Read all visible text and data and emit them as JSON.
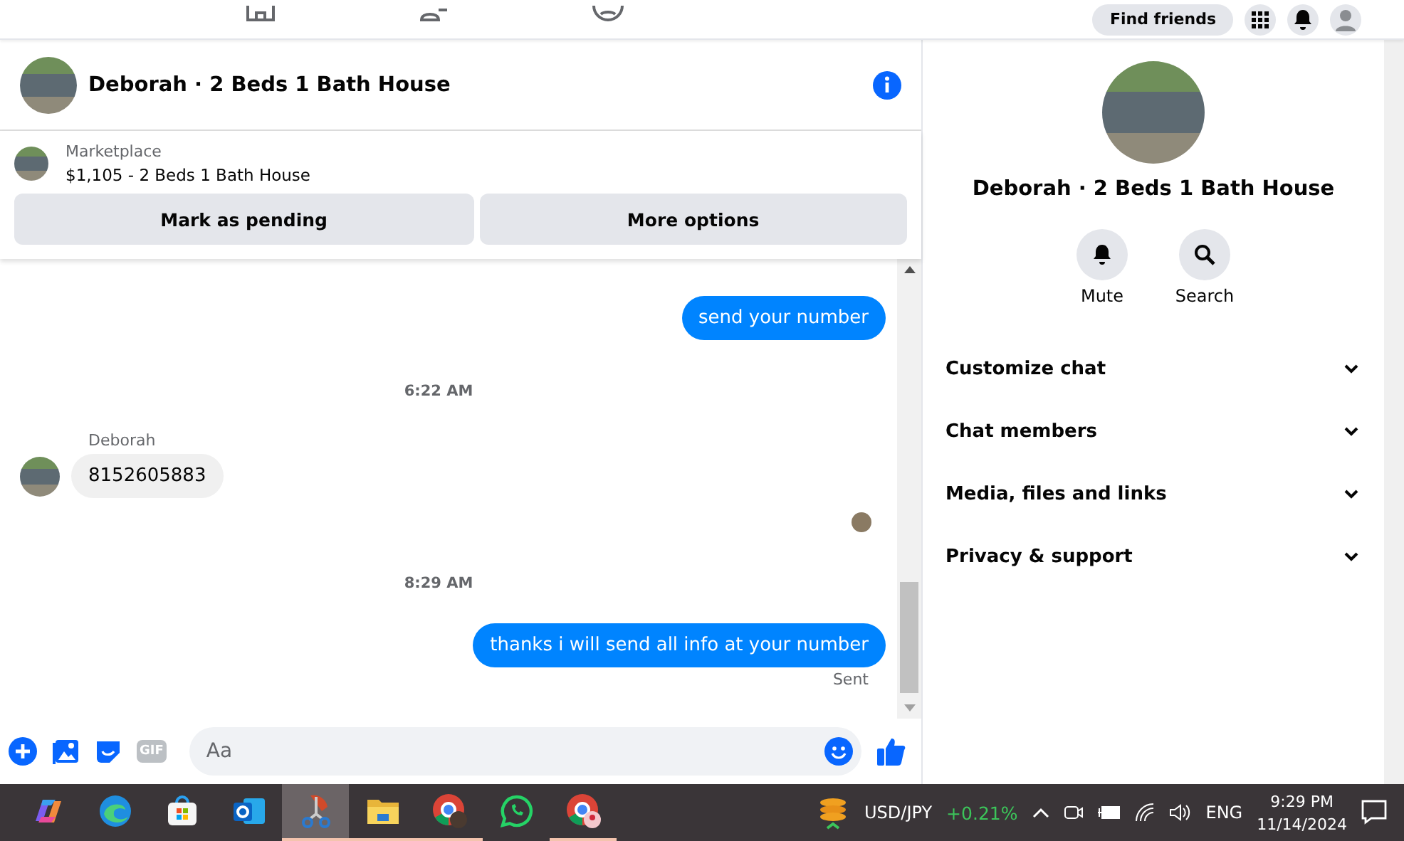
{
  "top_nav": {
    "find_friends": "Find friends"
  },
  "chat_header": {
    "title": "Deborah · 2 Beds 1 Bath House"
  },
  "listing": {
    "source": "Marketplace",
    "title": "$1,105 - 2 Beds 1 Bath House",
    "buttons": [
      "Mark as pending",
      "More options"
    ]
  },
  "messages": [
    {
      "kind": "outgoing",
      "text": "send your number"
    },
    {
      "kind": "time",
      "text": "6:22 AM"
    },
    {
      "kind": "sender",
      "text": "Deborah"
    },
    {
      "kind": "incoming",
      "text": "8152605883"
    },
    {
      "kind": "seen"
    },
    {
      "kind": "time",
      "text": "8:29 AM"
    },
    {
      "kind": "outgoing",
      "text": "thanks i will send all info at your number"
    },
    {
      "kind": "status",
      "text": "Sent"
    }
  ],
  "composer": {
    "placeholder": "Aa",
    "gif": "GIF"
  },
  "details": {
    "title": "Deborah · 2 Beds 1 Bath House",
    "actions": [
      {
        "kind": "bell",
        "label": "Mute"
      },
      {
        "kind": "search",
        "label": "Search"
      }
    ],
    "sections": [
      {
        "label": "Customize chat",
        "expanded": false
      },
      {
        "label": "Chat members",
        "expanded": false
      },
      {
        "label": "Media, files and links",
        "expanded": false
      },
      {
        "label": "Privacy & support",
        "expanded": false
      }
    ]
  },
  "taskbar": {
    "apps": [
      {
        "kind": "copilot",
        "selected": false,
        "running": false
      },
      {
        "kind": "edge",
        "selected": false,
        "running": false
      },
      {
        "kind": "store",
        "selected": false,
        "running": false
      },
      {
        "kind": "outlook",
        "selected": false,
        "running": false
      },
      {
        "kind": "snip",
        "selected": true,
        "running": true
      },
      {
        "kind": "folder",
        "selected": false,
        "running": true
      },
      {
        "kind": "chrome-c",
        "selected": false,
        "running": true
      },
      {
        "kind": "whatsapp",
        "selected": false,
        "running": false
      },
      {
        "kind": "chrome-p",
        "selected": false,
        "running": true
      }
    ],
    "ticker": {
      "symbol": "USD/JPY",
      "change": "+0.21%"
    },
    "language": "ENG",
    "time": "9:29 PM",
    "date": "11/14/2024"
  }
}
